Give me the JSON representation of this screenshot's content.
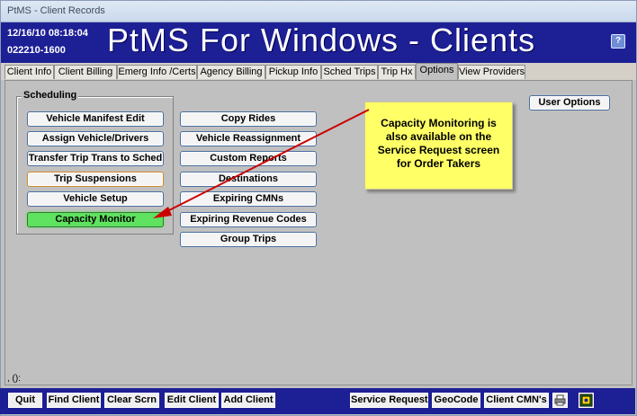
{
  "window": {
    "title": "PtMS - Client Records"
  },
  "header": {
    "datetime": "12/16/10  08:18:04",
    "client_id": "022210-1600",
    "app_title": "PtMS For Windows - Clients",
    "help_label": "?"
  },
  "tabs": [
    {
      "label": "Client Info"
    },
    {
      "label": "Client Billing"
    },
    {
      "label": "Emerg Info /Certs"
    },
    {
      "label": "Agency Billing"
    },
    {
      "label": "Pickup Info"
    },
    {
      "label": "Sched Trips"
    },
    {
      "label": "Trip Hx"
    },
    {
      "label": "Options",
      "active": true
    },
    {
      "label": "View Providers"
    }
  ],
  "scheduling": {
    "legend": "Scheduling",
    "buttons": [
      "Vehicle Manifest Edit",
      "Assign Vehicle/Drivers",
      "Transfer Trip Trans to Sched",
      "Trip Suspensions",
      "Vehicle Setup",
      "Capacity Monitor"
    ]
  },
  "middle_buttons": [
    "Copy Rides",
    "Vehicle Reassignment",
    "Custom Reports",
    "Destinations",
    "Expiring CMNs",
    "Expiring Revenue Codes",
    "Group Trips"
  ],
  "user_options_label": "User Options",
  "note": {
    "lines": [
      "Capacity Monitoring is",
      "also available on the",
      "Service Request screen",
      "for Order Takers"
    ]
  },
  "coords_text": ", ():",
  "bottom_buttons": {
    "quit": "Quit",
    "find_client": "Find Client",
    "clear_scrn": "Clear Scrn",
    "edit_client": "Edit Client",
    "add_client": "Add Client",
    "service_request": "Service Request",
    "geocode": "GeoCode",
    "client_cmns": "Client CMN's"
  },
  "colors": {
    "header_bg": "#1d1f95",
    "capacity_green": "#5fe25f",
    "note_yellow": "#ffff66",
    "arrow_red": "#cc0000"
  }
}
